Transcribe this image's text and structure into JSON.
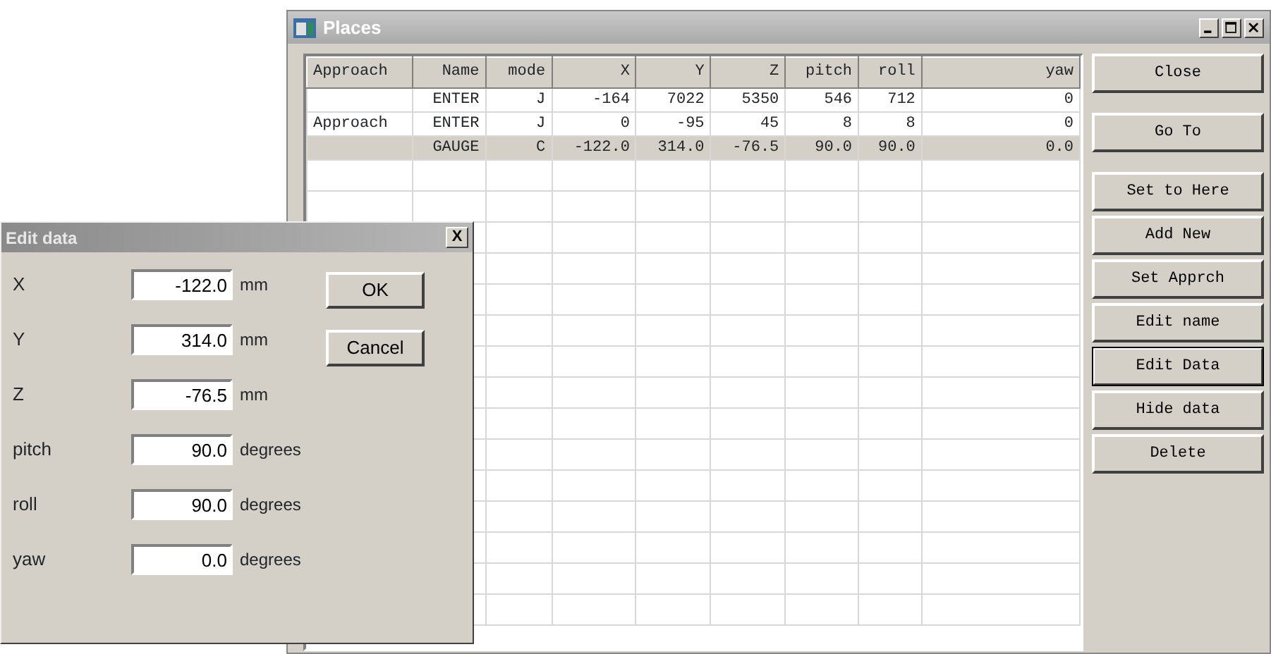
{
  "places_window": {
    "title": "Places",
    "table": {
      "columns": [
        "Approach",
        "Name",
        "mode",
        "X",
        "Y",
        "Z",
        "pitch",
        "roll",
        "yaw"
      ],
      "rows": [
        {
          "cells": [
            "",
            "ENTER",
            "J",
            "-164",
            "7022",
            "5350",
            "546",
            "712",
            "0"
          ],
          "selected": false
        },
        {
          "cells": [
            "Approach",
            "ENTER",
            "J",
            "0",
            "-95",
            "45",
            "8",
            "8",
            "0"
          ],
          "selected": false
        },
        {
          "cells": [
            "",
            "GAUGE",
            "C",
            "-122.0",
            "314.0",
            "-76.5",
            "90.0",
            "90.0",
            "0.0"
          ],
          "selected": true
        }
      ]
    },
    "buttons": [
      {
        "label": "Close",
        "default": false
      },
      {
        "label": "Go To",
        "default": false
      },
      {
        "label": "Set to Here",
        "default": false
      },
      {
        "label": "Add New",
        "default": false
      },
      {
        "label": "Set Apprch",
        "default": false
      },
      {
        "label": "Edit name",
        "default": false
      },
      {
        "label": "Edit Data",
        "default": true
      },
      {
        "label": "Hide data",
        "default": false
      },
      {
        "label": "Delete",
        "default": false
      }
    ]
  },
  "edit_dialog": {
    "title": "Edit data",
    "close": "X",
    "fields": [
      {
        "label": "X",
        "value": "-122.0",
        "unit": "mm"
      },
      {
        "label": "Y",
        "value": "314.0",
        "unit": "mm"
      },
      {
        "label": "Z",
        "value": "-76.5",
        "unit": "mm"
      },
      {
        "label": "pitch",
        "value": "90.0",
        "unit": "degrees"
      },
      {
        "label": "roll",
        "value": "90.0",
        "unit": "degrees"
      },
      {
        "label": "yaw",
        "value": "0.0",
        "unit": "degrees"
      }
    ],
    "buttons": [
      "OK",
      "Cancel"
    ]
  }
}
